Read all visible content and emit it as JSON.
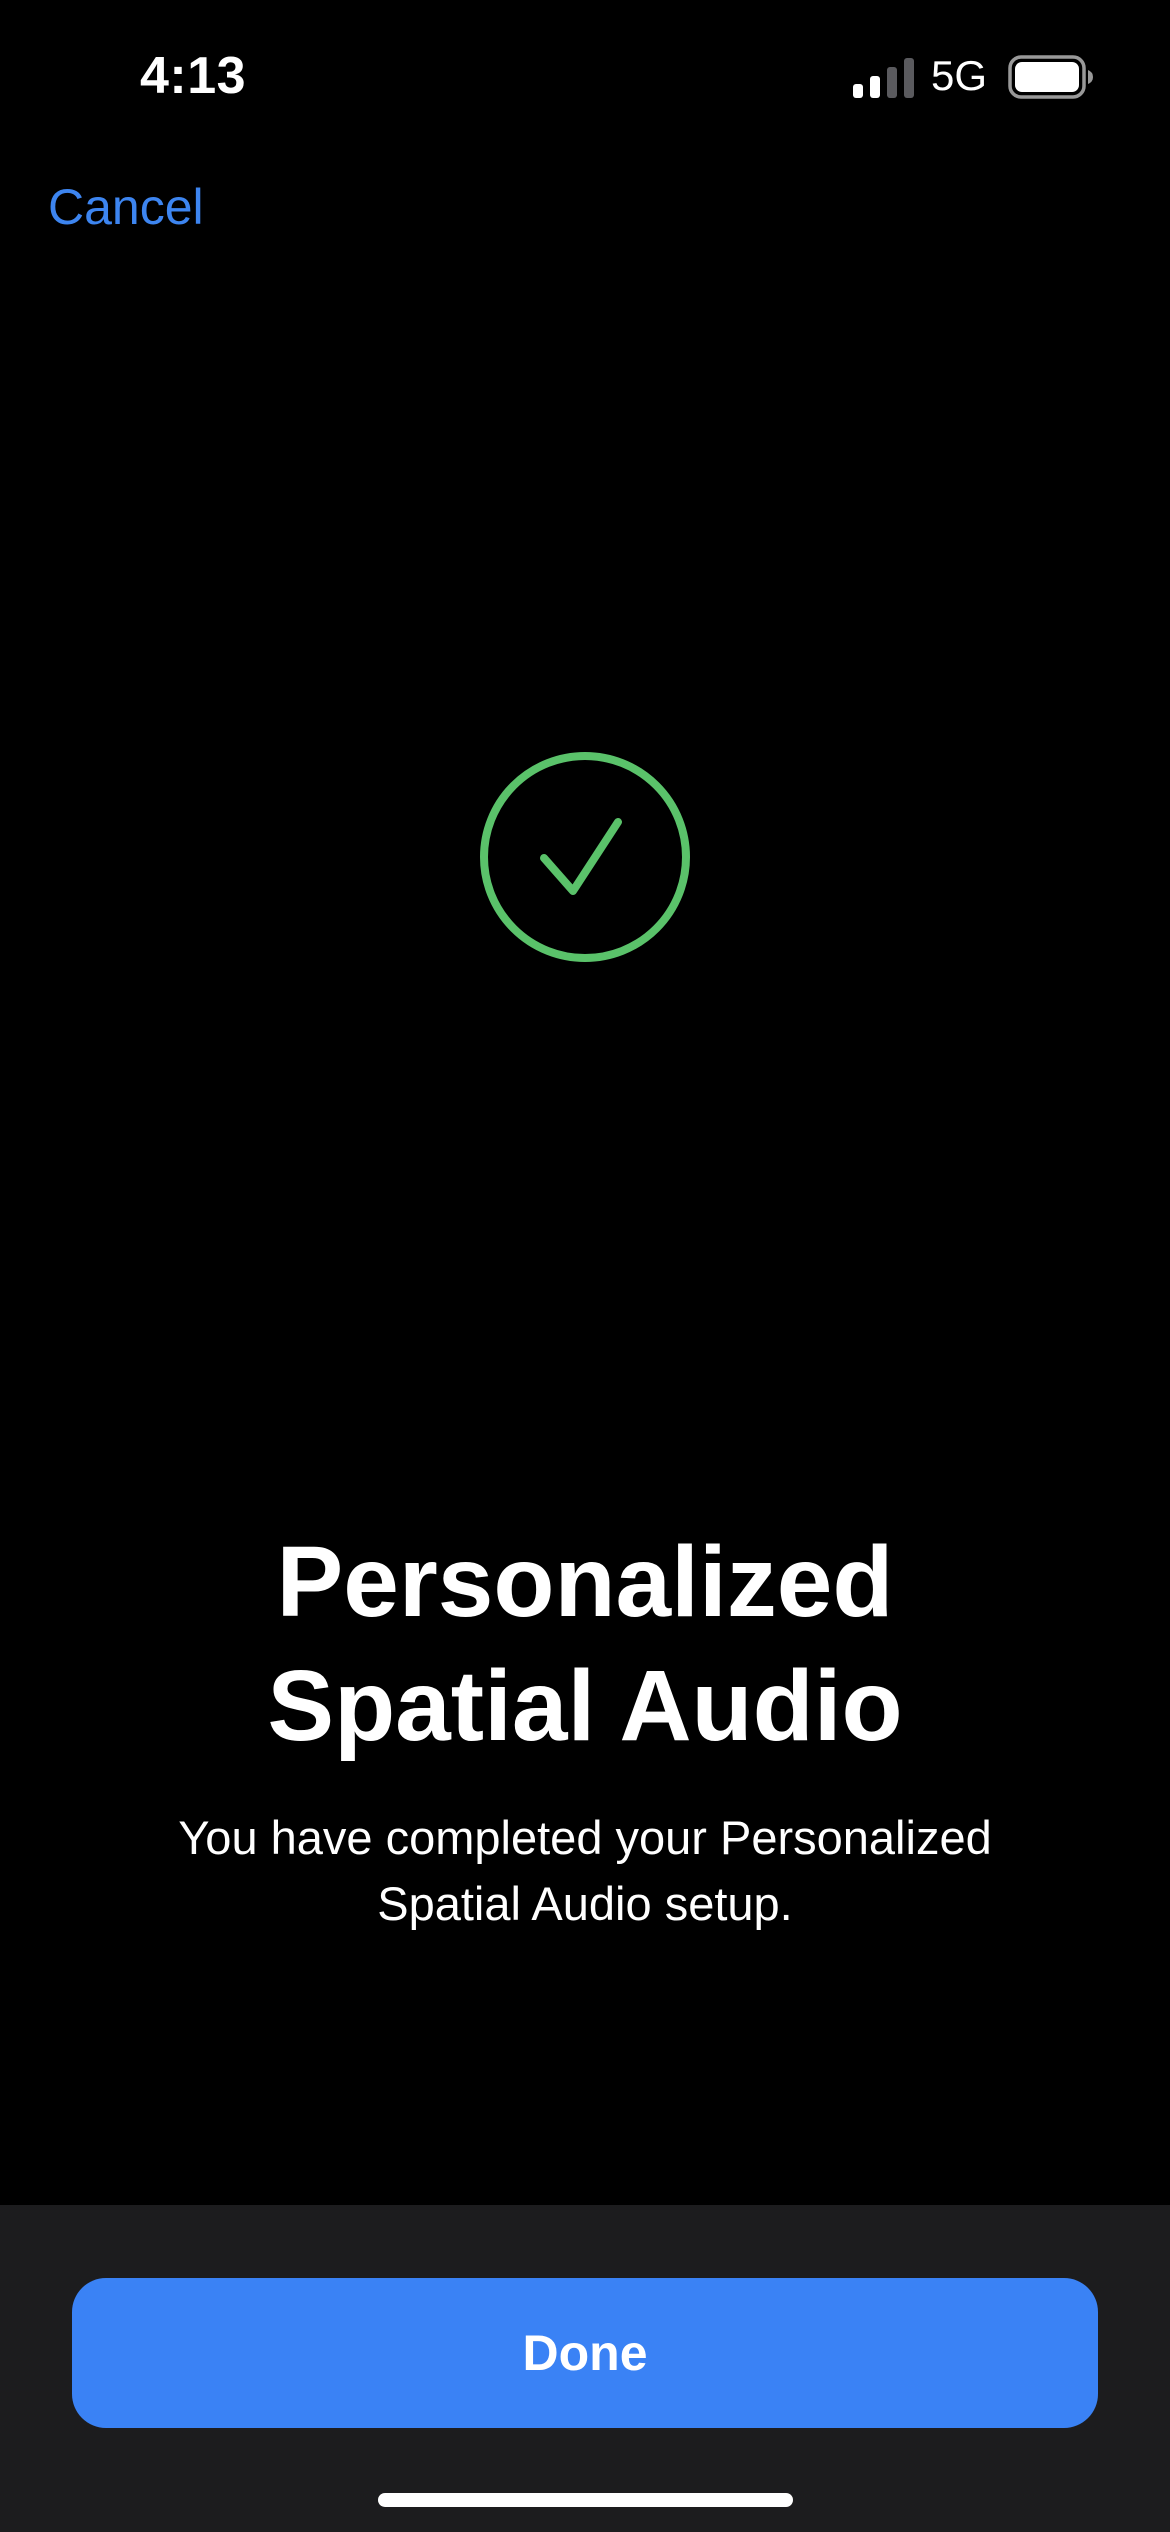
{
  "status_bar": {
    "time": "4:13",
    "network": "5G",
    "signal_icon": "cellular-signal-icon",
    "battery_icon": "battery-icon"
  },
  "nav": {
    "cancel_label": "Cancel"
  },
  "main": {
    "icon": "checkmark-circle-icon",
    "title": "Personalized\nSpatial Audio",
    "subtitle": "You have completed your Personalized\nSpatial Audio setup."
  },
  "footer": {
    "done_label": "Done"
  },
  "colors": {
    "accent": "#3a82f5",
    "link": "#3d85f0",
    "success": "#5ac26a",
    "background": "#000000",
    "panel": "#1c1c1e"
  }
}
